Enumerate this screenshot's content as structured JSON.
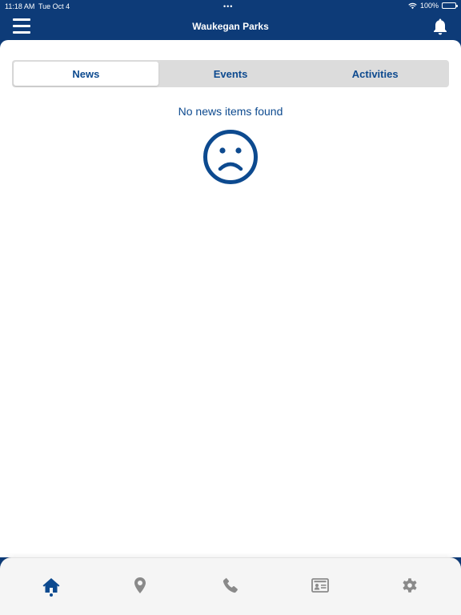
{
  "status_bar": {
    "time": "11:18 AM",
    "date": "Tue Oct 4",
    "battery": "100%"
  },
  "header": {
    "title": "Waukegan Parks",
    "menu_icon": "hamburger-menu-icon",
    "bell_icon": "bell-icon"
  },
  "tabs": [
    {
      "label": "News",
      "active": true
    },
    {
      "label": "Events",
      "active": false
    },
    {
      "label": "Activities",
      "active": false
    }
  ],
  "empty_state": {
    "message": "No news items found",
    "icon": "sad-face-icon"
  },
  "bottom_tabs": [
    {
      "icon": "home-icon",
      "active": true
    },
    {
      "icon": "location-pin-icon",
      "active": false
    },
    {
      "icon": "phone-icon",
      "active": false
    },
    {
      "icon": "contact-card-icon",
      "active": false
    },
    {
      "icon": "gear-icon",
      "active": false
    }
  ],
  "colors": {
    "brand_navy": "#0d3b78",
    "accent_blue": "#0d4a8f",
    "inactive_gray": "#8a8a8a"
  }
}
